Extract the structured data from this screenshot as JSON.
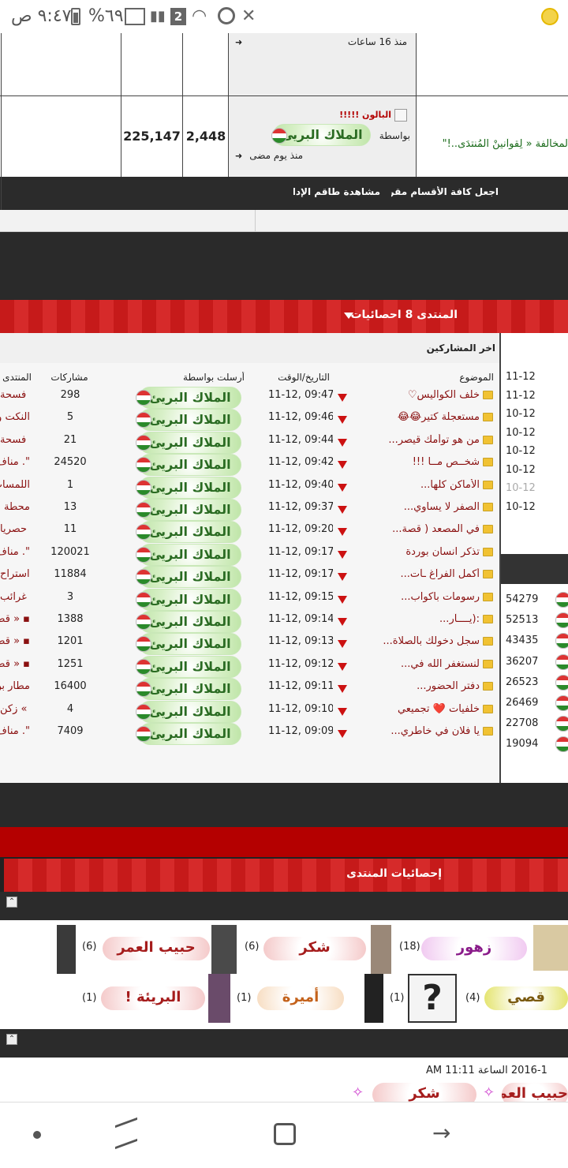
{
  "status_bar": {
    "time": "٩:٤٧ ص",
    "battery": "%٦٩",
    "sim": "2"
  },
  "top_table": {
    "row1_time": "منذ 16 ساعات",
    "row2_title": "البالون !!!!!",
    "row2_by": "بواسطة",
    "row2_user": "الملاك البريئ",
    "row2_time": "منذ يوم مضى",
    "row2_count1": "2,448",
    "row2_count2": "225,147",
    "row2_forum_text": "لمخالفة « لِقوآنينْ المُنتدَى..!\""
  },
  "links": {
    "mark_read": "اجعل كافة الأقسام مقروءة",
    "view_staff": "مشاهدة طاقم الإدارة"
  },
  "stats_section": {
    "header": "المنتدى 8 احصائيات",
    "subheader": "اخر المشاركين",
    "columns": {
      "topic": "الموضوع",
      "datetime": "التاريخ/الوقت",
      "sent_by": "أرسلت بواسطة",
      "posts": "مشاركات",
      "forum": "المنتدى"
    },
    "user_label": "الملاك البريئ",
    "rows": [
      {
        "topic": "خلف الكواليس♡",
        "time": "11-12, 09:47",
        "posts": "298",
        "forum": "فسحة"
      },
      {
        "topic": "مستعجلة كتير😂😂",
        "time": "11-12, 09:46",
        "posts": "5",
        "forum": "النكت و"
      },
      {
        "topic": "من هو توأمك قيصر...",
        "time": "11-12, 09:44",
        "posts": "21",
        "forum": "فسحة"
      },
      {
        "topic": "شخــص مــا !!!",
        "time": "11-12, 09:42",
        "posts": "24520",
        "forum": "\". منآف"
      },
      {
        "topic": "الأماكن كلها...",
        "time": "11-12, 09:40",
        "posts": "1",
        "forum": "اللمسات"
      },
      {
        "topic": "الصفر لا يساوي...",
        "time": "11-12, 09:37",
        "posts": "13",
        "forum": "محطة آ"
      },
      {
        "topic": "في المصعد ( قصة...",
        "time": "11-12, 09:20",
        "posts": "11",
        "forum": "حصريا"
      },
      {
        "topic": "تذكر انسان بوردة",
        "time": "11-12, 09:17",
        "posts": "120021",
        "forum": "\". منآف"
      },
      {
        "topic": "أكمل الفرآغ ـآت...",
        "time": "11-12, 09:17",
        "posts": "11884",
        "forum": "استراح"
      },
      {
        "topic": "رسومات باكواب...",
        "time": "11-12, 09:15",
        "posts": "3",
        "forum": "غرائب"
      },
      {
        "topic": ":(يــــآر...",
        "time": "11-12, 09:14",
        "posts": "1388",
        "forum": "▪ « قط"
      },
      {
        "topic": "سجل دخولك بالصلاة...",
        "time": "11-12, 09:13",
        "posts": "1201",
        "forum": "▪ « قط"
      },
      {
        "topic": "لنستغفر الله في...",
        "time": "11-12, 09:12",
        "posts": "1251",
        "forum": "▪ « قط"
      },
      {
        "topic": "دفتر الحضور...",
        "time": "11-12, 09:11",
        "posts": "16400",
        "forum": "مطار بن"
      },
      {
        "topic": "خلفيات ❤️ تجميعي",
        "time": "11-12, 09:10",
        "posts": "4",
        "forum": "» زكن"
      },
      {
        "topic": "يا فلان في خاطري...",
        "time": "11-12, 09:09",
        "posts": "7409",
        "forum": "\". منآف"
      }
    ],
    "side_dates": [
      "11-12",
      "11-12",
      "10-12",
      "10-12",
      "10-12",
      "10-12",
      "10-12",
      "10-12"
    ],
    "side_counts": [
      "54279",
      "52513",
      "43435",
      "36207",
      "26523",
      "26469",
      "22708",
      "19094"
    ]
  },
  "forum_stats": {
    "header": "إحصائيات المنتدى",
    "users_row1": [
      {
        "name": "حبيب العمر",
        "count": "(6)"
      },
      {
        "name": "شكر",
        "count": "(6)"
      },
      {
        "name": "زهور",
        "count": "(18)"
      }
    ],
    "users_row2": [
      {
        "name": "البريئة !",
        "count": "(1)"
      },
      {
        "name": "أميرة",
        "count": "(1)"
      },
      {
        "name": "",
        "count": "(1)"
      },
      {
        "name": "قصي",
        "count": "(4)"
      }
    ],
    "date_line": "2016-1 الساعة 11:11 AM",
    "bottom_names": [
      "شكر",
      "حبيب العمر"
    ]
  },
  "colors": {
    "red_bar": "#c61a1a",
    "dark_band": "#2a2a2a",
    "pill_green": "#2a6b22"
  }
}
